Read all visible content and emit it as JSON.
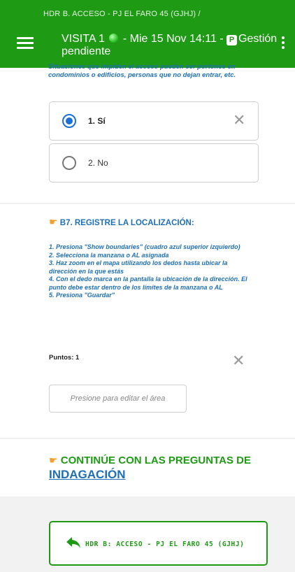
{
  "header": {
    "breadcrumb": "HDR B. ACCESO - PJ EL FARO 45 (GJHJ) /",
    "title_prefix": "VISITA 1",
    "title_mid": " - Mie 15 Nov 14:11 - ",
    "badge": "P",
    "title_suffix": "Gestión pendiente"
  },
  "access_question": {
    "hint": "Situaciones que impiden el acceso pueden ser portones en condominios o edificios, personas que no dejan entrar, etc.",
    "options": [
      {
        "label": "1. Sí",
        "selected": true
      },
      {
        "label": "2. No",
        "selected": false
      }
    ]
  },
  "location_question": {
    "title": "B7. REGISTRE LA LOCALIZACIÓN:",
    "instructions": [
      "1. Presiona \"Show boundaries\" (cuadro azul superior izquierdo)",
      "2. Selecciona la manzana o AL asignada",
      "3. Haz zoom en el mapa utilizando los dedos hasta ubicar la dirección en la que estás",
      "4. Con el dedo marca en la pantalla la ubicación de la dirección. El punto debe estar dentro de los límites de la manzana o AL",
      "5. Presiona \"Guardar\""
    ],
    "points_label": "Puntos: 1",
    "edit_area": "Presione para editar el área"
  },
  "continue": {
    "text": "CONTINÚE CON LAS PREGUNTAS DE",
    "link": "INDAGACIÓN"
  },
  "back_button": {
    "label": "HDR B: ACCESO - PJ EL FARO 45 (GJHJ)"
  },
  "colors": {
    "header_green": "#1e9a14",
    "accent_blue": "#1f6fb6",
    "radio_blue": "#1c6fd6"
  }
}
